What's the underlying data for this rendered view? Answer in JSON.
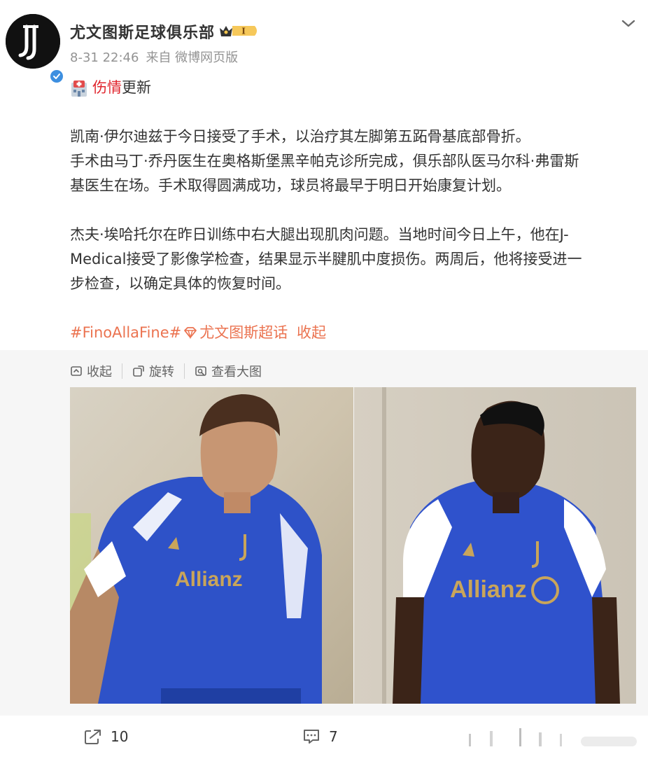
{
  "post": {
    "author": "尤文图斯足球俱乐部",
    "badge_level": "I",
    "timestamp": "8-31 22:46",
    "source": "来自 微博网页版",
    "headline_red": "伤情",
    "headline_rest": "更新",
    "paragraph1": [
      "凯南·伊尔迪兹于今日接受了手术，以治疗其左脚第五跖骨基底部骨折。",
      "手术由马丁·乔丹医生在奥格斯堡黑辛帕克诊所完成，俱乐部队医马尔科·弗雷斯",
      "基医生在场。手术取得圆满成功，球员将最早于明日开始康复计划。"
    ],
    "paragraph2": [
      "杰夫·埃哈托尔在昨日训练中右大腿出现肌肉问题。当地时间今日上午，他在J-",
      "Medical接受了影像学检查，结果显示半腱肌中度损伤。两周后，他将接受进一",
      "步检查，以确定具体的恢复时间。"
    ],
    "hashtag": "#FinoAllaFine#",
    "supertopic": "尤文图斯超话",
    "collapse_link": "收起"
  },
  "media_toolbar": {
    "collapse": "收起",
    "rotate": "旋转",
    "view_large": "查看大图"
  },
  "photos": [
    {
      "name": "player-photo-left",
      "jersey_sponsor": "Allianz"
    },
    {
      "name": "player-photo-right",
      "jersey_sponsor": "Allianz"
    }
  ],
  "footer": {
    "share_count": "10",
    "comment_count": "7"
  },
  "colors": {
    "link": "#eb7350",
    "red": "#e0242c",
    "verify": "#3d8fe0",
    "jersey_blue": "#2a4fc2",
    "meta_gray": "#939393"
  },
  "icons": [
    "juventus-logo-icon",
    "verified-icon",
    "crown-badge-icon",
    "chevron-down-icon",
    "hospital-icon",
    "supertopic-gem-icon",
    "collapse-icon",
    "rotate-icon",
    "view-large-icon",
    "share-icon",
    "comment-icon"
  ]
}
